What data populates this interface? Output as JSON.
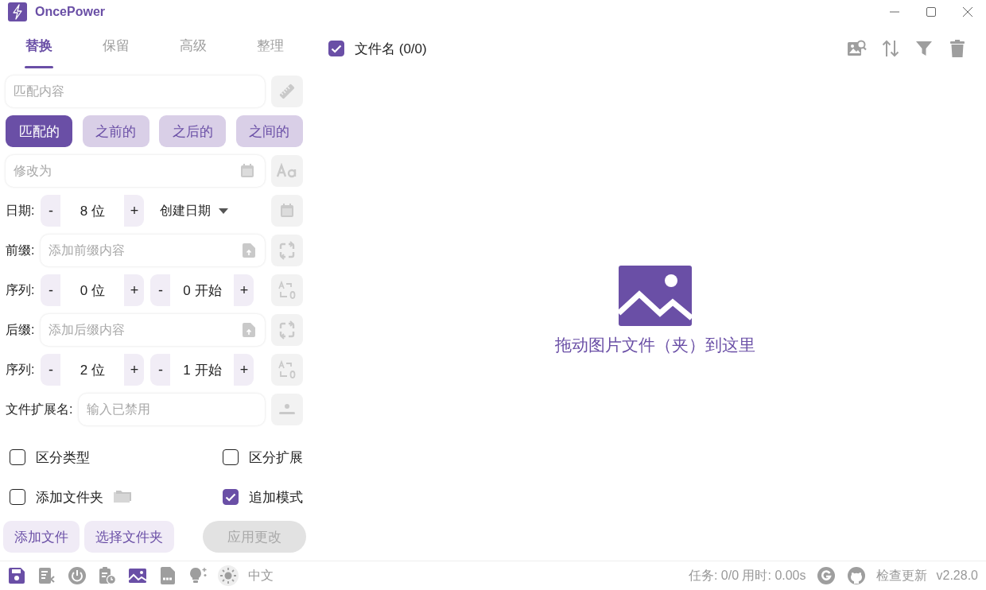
{
  "window": {
    "title": "OncePower"
  },
  "tabs": [
    {
      "label": "替换",
      "selected": true
    },
    {
      "label": "保留",
      "selected": false
    },
    {
      "label": "高级",
      "selected": false
    },
    {
      "label": "整理",
      "selected": false
    }
  ],
  "match_field": {
    "placeholder": "匹配内容"
  },
  "match_modes": [
    {
      "label": "匹配的",
      "selected": true
    },
    {
      "label": "之前的",
      "selected": false
    },
    {
      "label": "之后的",
      "selected": false
    },
    {
      "label": "之间的",
      "selected": false
    }
  ],
  "replace_field": {
    "placeholder": "修改为"
  },
  "rows": [
    {
      "kind": "date",
      "label": "日期:",
      "stepper": {
        "dec": "-",
        "value": "8 位",
        "inc": "+"
      },
      "date_type": "创建日期"
    },
    {
      "kind": "text",
      "label": "前缀:",
      "placeholder": "添加前缀内容"
    },
    {
      "kind": "sequence",
      "label": "序列:",
      "steppers": [
        {
          "dec": "-",
          "value": "0 位",
          "inc": "+"
        },
        {
          "dec": "-",
          "value": "0 开始",
          "inc": "+"
        }
      ]
    },
    {
      "kind": "text",
      "label": "后缀:",
      "placeholder": "添加后缀内容"
    },
    {
      "kind": "sequence",
      "label": "序列:",
      "steppers": [
        {
          "dec": "-",
          "value": "2 位",
          "inc": "+"
        },
        {
          "dec": "-",
          "value": "1 开始",
          "inc": "+"
        }
      ]
    },
    {
      "kind": "extension",
      "label": "文件扩展名:",
      "placeholder": "输入已禁用"
    }
  ],
  "options": [
    {
      "kind": "plain",
      "label": "区分类型",
      "checked": false
    },
    {
      "kind": "plain",
      "label": "区分扩展",
      "checked": false
    },
    {
      "kind": "folder",
      "label": "添加文件夹",
      "checked": false
    },
    {
      "kind": "plain",
      "label": "追加模式",
      "checked": true
    }
  ],
  "actions": [
    {
      "label": "添加文件",
      "disabled": false
    },
    {
      "label": "选择文件夹",
      "disabled": false
    },
    {
      "label": "应用更改",
      "disabled": true
    }
  ],
  "file_list": {
    "header": {
      "label": "文件名 (0/0)",
      "checked": true
    },
    "empty_text": "拖动图片文件（夹）到这里"
  },
  "footer": {
    "language": "中文",
    "status": "任务: 0/0 用时: 0.00s",
    "update": "检查更新",
    "version": "v2.28.0"
  }
}
